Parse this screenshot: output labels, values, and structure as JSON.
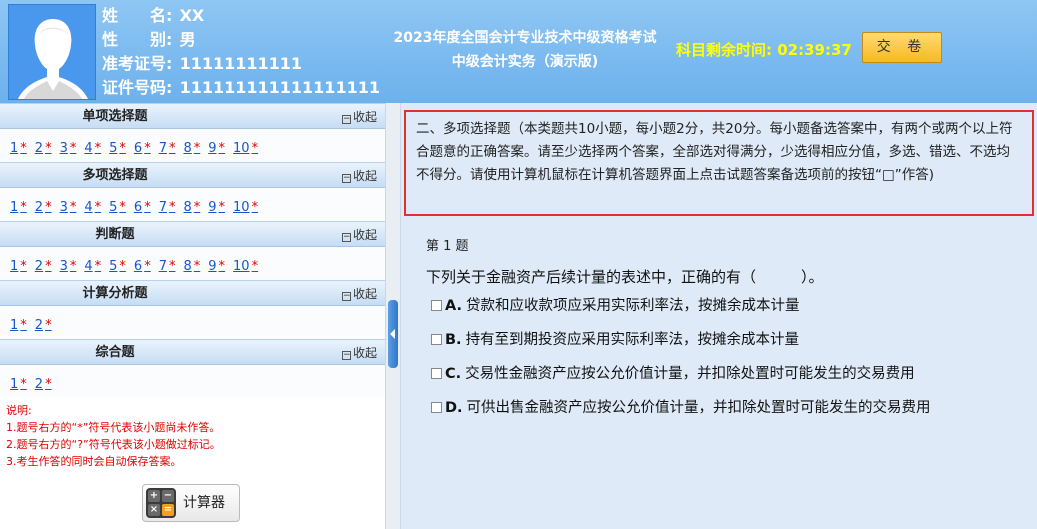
{
  "candidate": {
    "name_label": "姓　　名:",
    "name": "XX",
    "gender_label": "性　　别:",
    "gender": "男",
    "ticket_label": "准考证号:",
    "ticket": "11111111111",
    "id_label": "证件号码:",
    "id": "111111111111111111"
  },
  "exam": {
    "title_line1": "2023年度全国会计专业技术中级资格考试",
    "title_line2": "中级会计实务（演示版)"
  },
  "timer": {
    "label": "科目剩余时间:",
    "value": "02:39:37"
  },
  "submit_label": "交 卷",
  "sections": [
    {
      "title": "单项选择题",
      "collapse": "收起",
      "questions": [
        {
          "n": "1",
          "m": "*"
        },
        {
          "n": "2",
          "m": "*"
        },
        {
          "n": "3",
          "m": "*"
        },
        {
          "n": "4",
          "m": "*"
        },
        {
          "n": "5",
          "m": "*"
        },
        {
          "n": "6",
          "m": "*"
        },
        {
          "n": "7",
          "m": "*"
        },
        {
          "n": "8",
          "m": "*"
        },
        {
          "n": "9",
          "m": "*"
        },
        {
          "n": "10",
          "m": "*"
        }
      ]
    },
    {
      "title": "多项选择题",
      "collapse": "收起",
      "questions": [
        {
          "n": "1",
          "m": "*"
        },
        {
          "n": "2",
          "m": "*"
        },
        {
          "n": "3",
          "m": "*"
        },
        {
          "n": "4",
          "m": "*"
        },
        {
          "n": "5",
          "m": "*"
        },
        {
          "n": "6",
          "m": "*"
        },
        {
          "n": "7",
          "m": "*"
        },
        {
          "n": "8",
          "m": "*"
        },
        {
          "n": "9",
          "m": "*"
        },
        {
          "n": "10",
          "m": "*"
        }
      ]
    },
    {
      "title": "判断题",
      "collapse": "收起",
      "questions": [
        {
          "n": "1",
          "m": "*"
        },
        {
          "n": "2",
          "m": "*"
        },
        {
          "n": "3",
          "m": "*"
        },
        {
          "n": "4",
          "m": "*"
        },
        {
          "n": "5",
          "m": "*"
        },
        {
          "n": "6",
          "m": "*"
        },
        {
          "n": "7",
          "m": "*"
        },
        {
          "n": "8",
          "m": "*"
        },
        {
          "n": "9",
          "m": "*"
        },
        {
          "n": "10",
          "m": "*"
        }
      ]
    },
    {
      "title": "计算分析题",
      "collapse": "收起",
      "questions": [
        {
          "n": "1",
          "m": "*"
        },
        {
          "n": "2",
          "m": "*"
        }
      ]
    },
    {
      "title": "综合题",
      "collapse": "收起",
      "questions": [
        {
          "n": "1",
          "m": "*"
        },
        {
          "n": "2",
          "m": "*"
        }
      ]
    }
  ],
  "notes": [
    "说明:",
    "1.题号右方的“*”符号代表该小题尚未作答。",
    "2.题号右方的“?”符号代表该小题做过标记。",
    "3.考生作答的同时会自动保存答案。"
  ],
  "calculator_label": "计算器",
  "instructions": "二、多项选择题（本类题共10小题，每小题2分，共20分。每小题备选答案中，有两个或两个以上符合题意的正确答案。请至少选择两个答案，全部选对得满分，少选得相应分值，多选、错选、不选均不得分。请使用计算机鼠标在计算机答题界面上点击试题答案备选项前的按钮“□”作答)",
  "question": {
    "number": "第 1 题",
    "stem": "下列关于金融资产后续计量的表述中，正确的有（　　　）。",
    "options": [
      {
        "letter": "A.",
        "text": "贷款和应收款项应采用实际利率法，按摊余成本计量"
      },
      {
        "letter": "B.",
        "text": "持有至到期投资应采用实际利率法，按摊余成本计量"
      },
      {
        "letter": "C.",
        "text": "交易性金融资产应按公允价值计量，并扣除处置时可能发生的交易费用"
      },
      {
        "letter": "D.",
        "text": "可供出售金融资产应按公允价值计量，并扣除处置时可能发生的交易费用"
      }
    ]
  },
  "colors": {
    "header_bg": "#7ab8ef",
    "timer": "#ffff00",
    "link": "#1a55cc",
    "unanswered_mark": "#e00000",
    "instruction_border": "#e03030",
    "right_bg": "#deeaf7"
  },
  "icons": [
    "avatar-silhouette",
    "collapse-minus-icon",
    "calculator-icon",
    "splitter-arrow-icon",
    "checkbox-icon"
  ]
}
